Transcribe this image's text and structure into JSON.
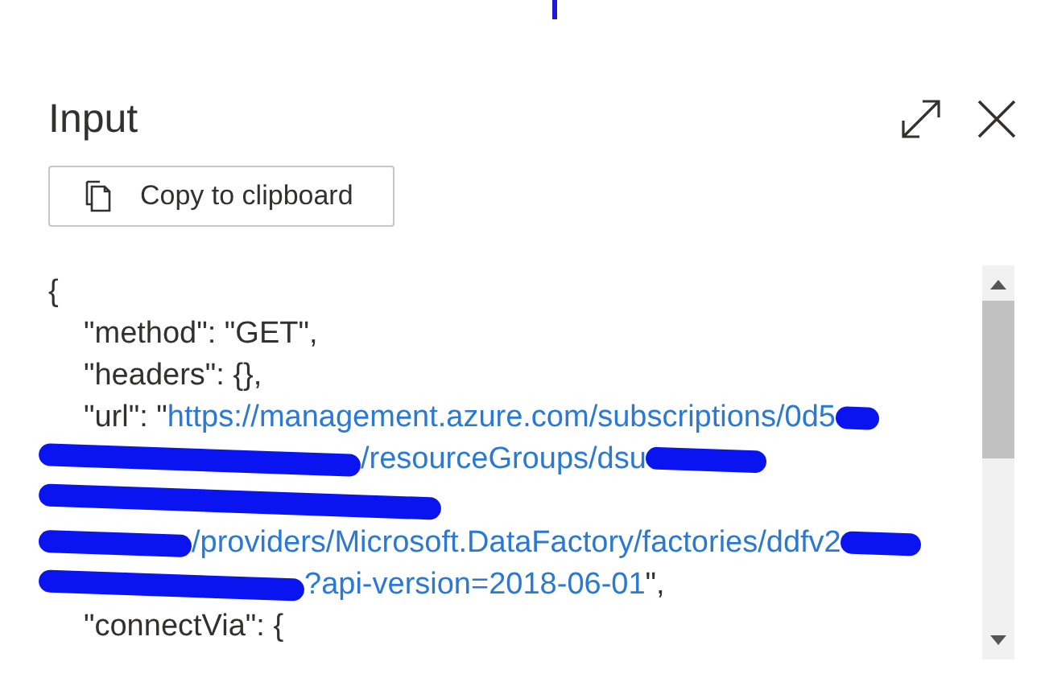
{
  "panel": {
    "title": "Input"
  },
  "toolbar": {
    "copy_button": "Copy to clipboard"
  },
  "code": {
    "lines": [
      {
        "indented": false,
        "segments": [
          {
            "kind": "plain",
            "text": "{"
          }
        ]
      },
      {
        "indented": true,
        "segments": [
          {
            "kind": "plain",
            "text": "\"method\": \"GET\","
          }
        ]
      },
      {
        "indented": true,
        "segments": [
          {
            "kind": "plain",
            "text": "\"headers\": {},"
          }
        ]
      },
      {
        "indented": true,
        "segments": [
          {
            "kind": "plain",
            "text": "\"url\": \""
          },
          {
            "kind": "link",
            "text": "https://management.azure.com/subscriptions/0d5"
          },
          {
            "kind": "redacted"
          }
        ]
      },
      {
        "indented": false,
        "segments": [
          {
            "kind": "redacted"
          },
          {
            "kind": "link",
            "text": "/resourceGroups/dsu"
          },
          {
            "kind": "redacted"
          }
        ]
      },
      {
        "indented": false,
        "segments": [
          {
            "kind": "redacted"
          }
        ]
      },
      {
        "indented": false,
        "segments": [
          {
            "kind": "redacted"
          },
          {
            "kind": "link",
            "text": "/providers/Microsoft.DataFactory/factories/ddfv2"
          },
          {
            "kind": "redacted"
          }
        ]
      },
      {
        "indented": false,
        "segments": [
          {
            "kind": "redacted"
          },
          {
            "kind": "link",
            "text": "?api-version=2018-06-01"
          },
          {
            "kind": "plain",
            "text": "\","
          }
        ]
      },
      {
        "indented": true,
        "segments": [
          {
            "kind": "plain",
            "text": "\"connectVia\": {"
          }
        ]
      }
    ]
  }
}
